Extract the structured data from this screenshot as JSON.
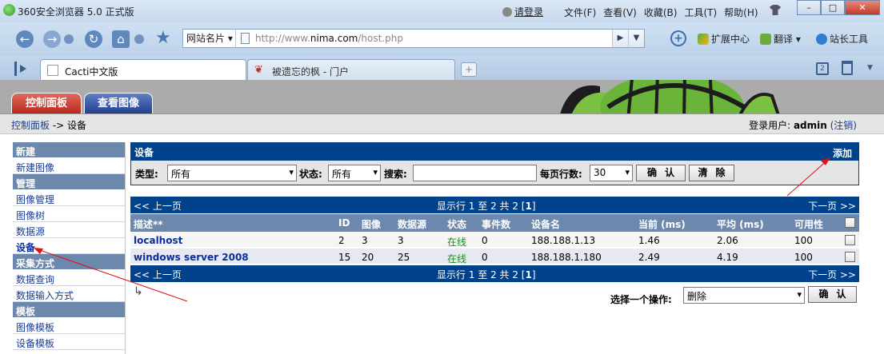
{
  "browser": {
    "title": "360安全浏览器 5.0 正式版",
    "login": "请登录",
    "menu": [
      "文件(F)",
      "查看(V)",
      "收藏(B)",
      "工具(T)",
      "帮助(H)"
    ],
    "win_buttons": [
      "–",
      "□",
      "✕"
    ],
    "site_card": "网站名片",
    "url_prefix": "http://www.",
    "url_host": "nima.com",
    "url_path": "/host.php",
    "toolbar": [
      "扩展中心",
      "翻译",
      "站长工具"
    ],
    "tabs": [
      {
        "label": "Cacti中文版"
      },
      {
        "label": "被遗忘的枫 - 门户"
      }
    ],
    "tab_count": "2"
  },
  "cacti": {
    "top_tabs": [
      "控制面板",
      "查看图像"
    ],
    "breadcrumb_link": "控制面板",
    "breadcrumb_rest": " -> 设备",
    "user_label": "登录用户: ",
    "user_name": "admin",
    "logout": "(注销)"
  },
  "sidebar": [
    {
      "type": "head",
      "label": "新建"
    },
    {
      "type": "item",
      "label": "新建图像"
    },
    {
      "type": "head",
      "label": "管理"
    },
    {
      "type": "item",
      "label": "图像管理"
    },
    {
      "type": "item",
      "label": "图像树"
    },
    {
      "type": "item",
      "label": "数据源"
    },
    {
      "type": "item",
      "label": "设备",
      "current": true
    },
    {
      "type": "head",
      "label": "采集方式"
    },
    {
      "type": "item",
      "label": "数据查询"
    },
    {
      "type": "item",
      "label": "数据输入方式"
    },
    {
      "type": "head",
      "label": "模板"
    },
    {
      "type": "item",
      "label": "图像模板"
    },
    {
      "type": "item",
      "label": "设备模板"
    }
  ],
  "filter": {
    "title": "设备",
    "add": "添加",
    "type_label": "类型:",
    "type_value": "所有",
    "status_label": "状态:",
    "status_value": "所有",
    "search_label": "搜索:",
    "search_value": "",
    "rows_label": "每页行数:",
    "rows_value": "30",
    "go": "确认",
    "clear": "清除"
  },
  "pager": {
    "prev": "<< 上一页",
    "info_a": "显示行 1 至 2 共 2 [",
    "info_page": "1",
    "info_b": "]",
    "next": "下一页 >>"
  },
  "table": {
    "columns": [
      "描述**",
      "ID",
      "图像",
      "数据源",
      "状态",
      "事件数",
      "设备名",
      "当前 (ms)",
      "平均 (ms)",
      "可用性"
    ],
    "rows": [
      [
        "localhost",
        "2",
        "3",
        "3",
        "在线",
        "0",
        "188.188.1.13",
        "1.46",
        "2.06",
        "100"
      ],
      [
        "windows server 2008",
        "15",
        "20",
        "25",
        "在线",
        "0",
        "188.188.1.180",
        "2.49",
        "4.19",
        "100"
      ]
    ]
  },
  "action": {
    "label": "选择一个操作:",
    "value": "删除",
    "go": "确认"
  }
}
